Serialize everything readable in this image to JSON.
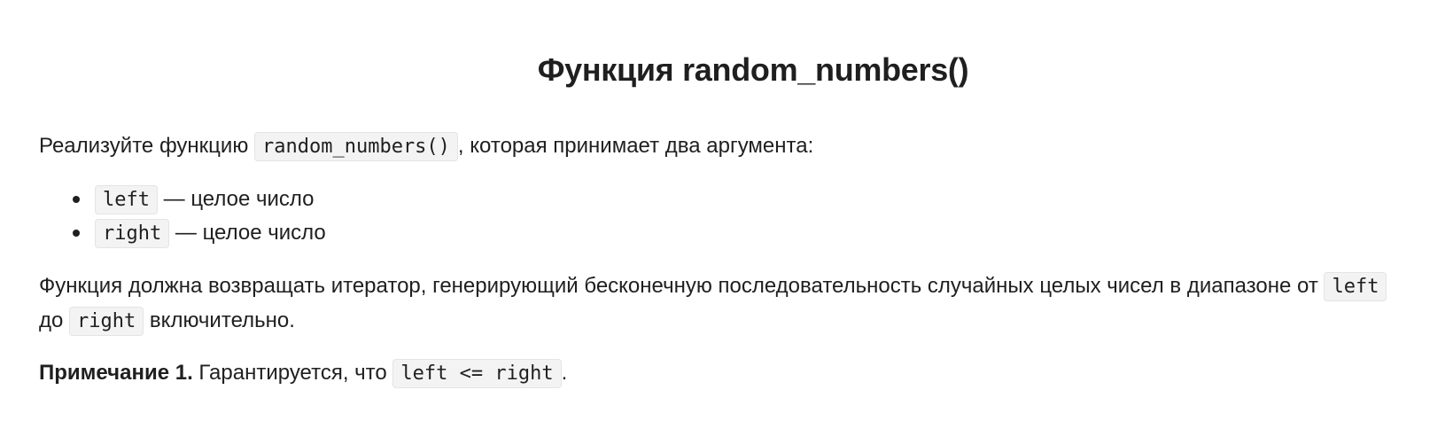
{
  "title": "Функция random_numbers()",
  "intro": {
    "before": "Реализуйте функцию ",
    "code": "random_numbers()",
    "after": ", которая принимает два аргумента:"
  },
  "args": [
    {
      "code": "left",
      "desc": " — целое число"
    },
    {
      "code": "right",
      "desc": " — целое число"
    }
  ],
  "description": {
    "text1": "Функция должна возвращать итератор, генерирующий бесконечную последовательность случайных целых чисел в диапазоне от ",
    "code1": "left",
    "text2": " до ",
    "code2": "right",
    "text3": " включительно."
  },
  "note": {
    "label": "Примечание 1.",
    "text": " Гарантируется, что ",
    "code": "left <= right",
    "end": "."
  }
}
